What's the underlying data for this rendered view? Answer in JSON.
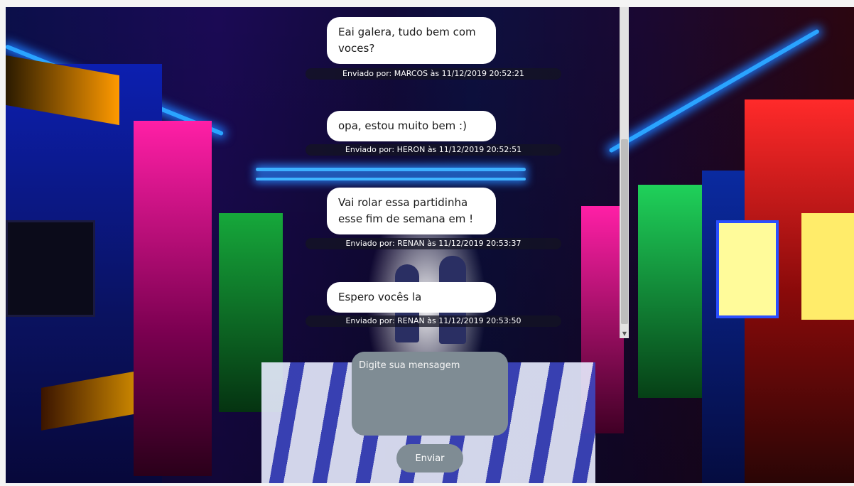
{
  "messages": [
    {
      "text": "Eai galera, tudo bem com voces?",
      "meta": "Enviado por: MARCOS às 11/12/2019 20:52:21"
    },
    {
      "text": "opa, estou muito bem :)",
      "meta": "Enviado por: HERON às 11/12/2019 20:52:51"
    },
    {
      "text": "Vai rolar essa partidinha esse fim de semana em !",
      "meta": "Enviado por: RENAN às 11/12/2019 20:53:37"
    },
    {
      "text": "Espero vocês la",
      "meta": "Enviado por: RENAN às 11/12/2019 20:53:50"
    }
  ],
  "composer": {
    "placeholder": "Digite sua mensagem",
    "value": ""
  },
  "send_label": "Enviar",
  "colors": {
    "bubble": "#ffffff",
    "meta_bg": "#14142380",
    "control": "#7f8c94"
  }
}
